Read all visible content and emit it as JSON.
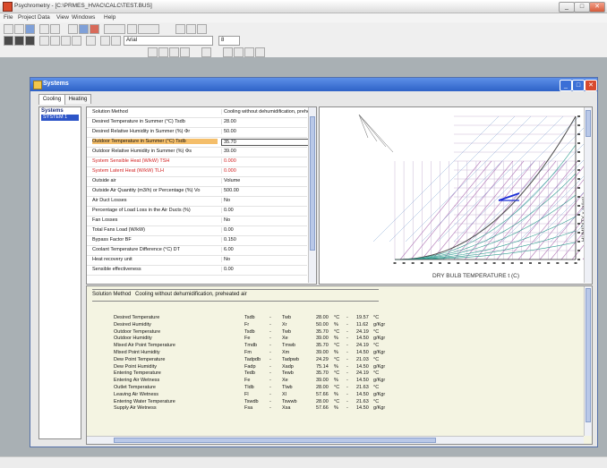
{
  "app": {
    "title": "Psychrometry - [C:\\PRMES_HVAC\\CALC\\TEST.BUS]",
    "window_controls": {
      "minimize": "_",
      "maximize": "□",
      "close": "✕"
    }
  },
  "menu": [
    "File",
    "Project Data",
    "View",
    "Windows",
    "Help"
  ],
  "toolbar": {
    "font_name": "Arial",
    "font_size": "8"
  },
  "child_window": {
    "title": "Systems",
    "tabs": [
      "Cooling",
      "Heating"
    ],
    "active_tab": "Cooling"
  },
  "systems": {
    "header": "Systems",
    "items": [
      "SYSTEM 1"
    ]
  },
  "grid": {
    "rows": [
      {
        "label": "Solution Method",
        "value": "Cooling without dehumidification, prehe",
        "style": ""
      },
      {
        "label": "Desired Temperature in Summer (°C) Tsdb",
        "value": "28.00",
        "style": ""
      },
      {
        "label": "Desired Relative Humidity in Summer (%) Φr",
        "value": "50.00",
        "style": ""
      },
      {
        "label": "Outdoor Temperature in Summer (°C) Tsdb",
        "value": "35.70",
        "style": "highlight"
      },
      {
        "label": "Outdoor Relative Humidity in Summer (%) Φs",
        "value": "39.00",
        "style": ""
      },
      {
        "label": "System Sensible Heat (W/kW) TSH",
        "value": "0.000",
        "style": "red"
      },
      {
        "label": "System Latent Heat (W/kW) TLH",
        "value": "0.000",
        "style": "red"
      },
      {
        "label": "Outside air",
        "value": "Volume",
        "style": ""
      },
      {
        "label": "Outside Air Quantity (m3/h) or Percentage (%) Vo",
        "value": "500.00",
        "style": ""
      },
      {
        "label": "Air Duct Losses",
        "value": "No",
        "style": ""
      },
      {
        "label": "Percentage of Load Loss in the Air Ducts (%)",
        "value": "0.00",
        "style": ""
      },
      {
        "label": "Fan Losses",
        "value": "No",
        "style": ""
      },
      {
        "label": "Total Fans Load (W/kW)",
        "value": "0.00",
        "style": ""
      },
      {
        "label": "Bypass Factor BF",
        "value": "0.150",
        "style": ""
      },
      {
        "label": "Coolant Temperature Difference (°C) DT",
        "value": "6.00",
        "style": ""
      },
      {
        "label": "Heat recovery unit",
        "value": "No",
        "style": ""
      },
      {
        "label": "Sensible effectiveness",
        "value": "0.00",
        "style": ""
      }
    ]
  },
  "chart_data": {
    "type": "psychrometric",
    "xlabel": "DRY BULB TEMPERATURE t (C)",
    "ylabel": "HUMIDITY x (g/kg)",
    "process_line_color": "#1b2fd6",
    "grid": true
  },
  "results": {
    "method_label": "Solution Method",
    "method_value": "Cooling without dehumidification, preheated air",
    "rows": [
      {
        "name": "Desired Temperature",
        "sym": "Tsdb",
        "eq": "Twb",
        "v1": "28.00",
        "u1": "°C",
        "v2": "19.57",
        "u2": "°C"
      },
      {
        "name": "Desired Humidity",
        "sym": "Fr",
        "eq": "Xr",
        "v1": "50.00",
        "u1": "%",
        "v2": "11.62",
        "u2": "g/Kgr"
      },
      {
        "name": "Outdoor Temperature",
        "sym": "Tsdb",
        "eq": "Twb",
        "v1": "35.70",
        "u1": "°C",
        "v2": "24.19",
        "u2": "°C"
      },
      {
        "name": "Outdoor Humidity",
        "sym": "Fe",
        "eq": "Xe",
        "v1": "39.00",
        "u1": "%",
        "v2": "14.50",
        "u2": "g/Kgr"
      },
      {
        "name": "Mixed Air Point Temperature",
        "sym": "Tmdb",
        "eq": "Tmwb",
        "v1": "35.70",
        "u1": "°C",
        "v2": "24.19",
        "u2": "°C"
      },
      {
        "name": "Mixed Point Humidity",
        "sym": "Fm",
        "eq": "Xm",
        "v1": "39.00",
        "u1": "%",
        "v2": "14.50",
        "u2": "g/Kgr"
      },
      {
        "name": "Dew Point Temperature",
        "sym": "Tadpdb",
        "eq": "Tadpwb",
        "v1": "24.29",
        "u1": "°C",
        "v2": "21.03",
        "u2": "°C"
      },
      {
        "name": "Dew Point Humidity",
        "sym": "Fadp",
        "eq": "Xadp",
        "v1": "75.14",
        "u1": "%",
        "v2": "14.50",
        "u2": "g/Kgr"
      },
      {
        "name": "Entering Temperature",
        "sym": "Tedb",
        "eq": "Tewb",
        "v1": "35.70",
        "u1": "°C",
        "v2": "24.19",
        "u2": "°C"
      },
      {
        "name": "Entering Air Wetness",
        "sym": "Fe",
        "eq": "Xe",
        "v1": "39.00",
        "u1": "%",
        "v2": "14.50",
        "u2": "g/Kgr"
      },
      {
        "name": "Outlet Temperature",
        "sym": "Tldb",
        "eq": "Tlwb",
        "v1": "28.00",
        "u1": "°C",
        "v2": "21.63",
        "u2": "°C"
      },
      {
        "name": "Leaving Air Wetness",
        "sym": "Fl",
        "eq": "Xl",
        "v1": "57.66",
        "u1": "%",
        "v2": "14.50",
        "u2": "g/Kgr"
      },
      {
        "name": "Entering Water Temperature",
        "sym": "Tswdb",
        "eq": "Tswwb",
        "v1": "28.00",
        "u1": "°C",
        "v2": "21.63",
        "u2": "°C"
      },
      {
        "name": "Supply Air Wetness",
        "sym": "Fsa",
        "eq": "Xsa",
        "v1": "57.66",
        "u1": "%",
        "v2": "14.50",
        "u2": "g/Kgr"
      }
    ]
  }
}
